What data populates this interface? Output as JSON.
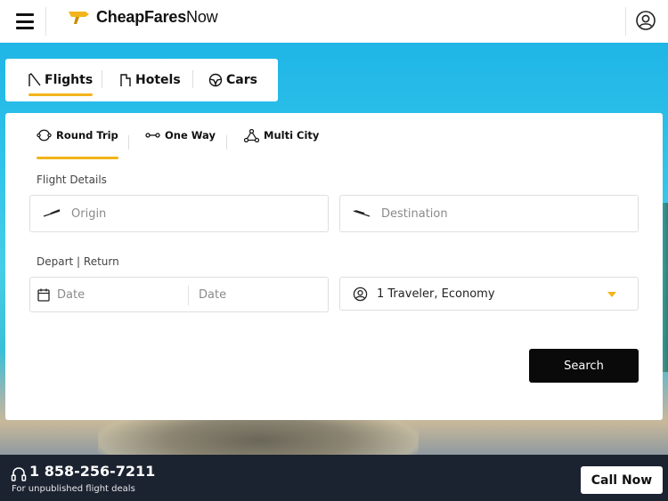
{
  "header": {
    "logo_bold": "CheapFares",
    "logo_regular": "Now",
    "menu_icon": "hamburger-menu-icon",
    "account_icon": "user-account-icon",
    "accent_color": "#f2b41a"
  },
  "product_tabs": [
    {
      "label": "Flights",
      "icon": "flight-icon",
      "active": true
    },
    {
      "label": "Hotels",
      "icon": "hotel-icon",
      "active": false
    },
    {
      "label": "Cars",
      "icon": "car-steering-icon",
      "active": false
    }
  ],
  "trip_types": [
    {
      "label": "Round Trip",
      "icon": "round-trip-icon",
      "active": true
    },
    {
      "label": "One Way",
      "icon": "one-way-icon",
      "active": false
    },
    {
      "label": "Multi City",
      "icon": "multi-city-icon",
      "active": false
    }
  ],
  "flight_details": {
    "label": "Flight Details",
    "origin_placeholder": "Origin",
    "destination_placeholder": "Destination"
  },
  "dates": {
    "label": "Depart | Return",
    "depart_placeholder": "Date",
    "return_placeholder": "Date"
  },
  "travelers": {
    "value": "1 Traveler, Economy"
  },
  "search_button": "Search",
  "footer": {
    "phone": "1 858-256-7211",
    "subtitle": "For unpublished flight deals",
    "call_button": "Call Now"
  }
}
